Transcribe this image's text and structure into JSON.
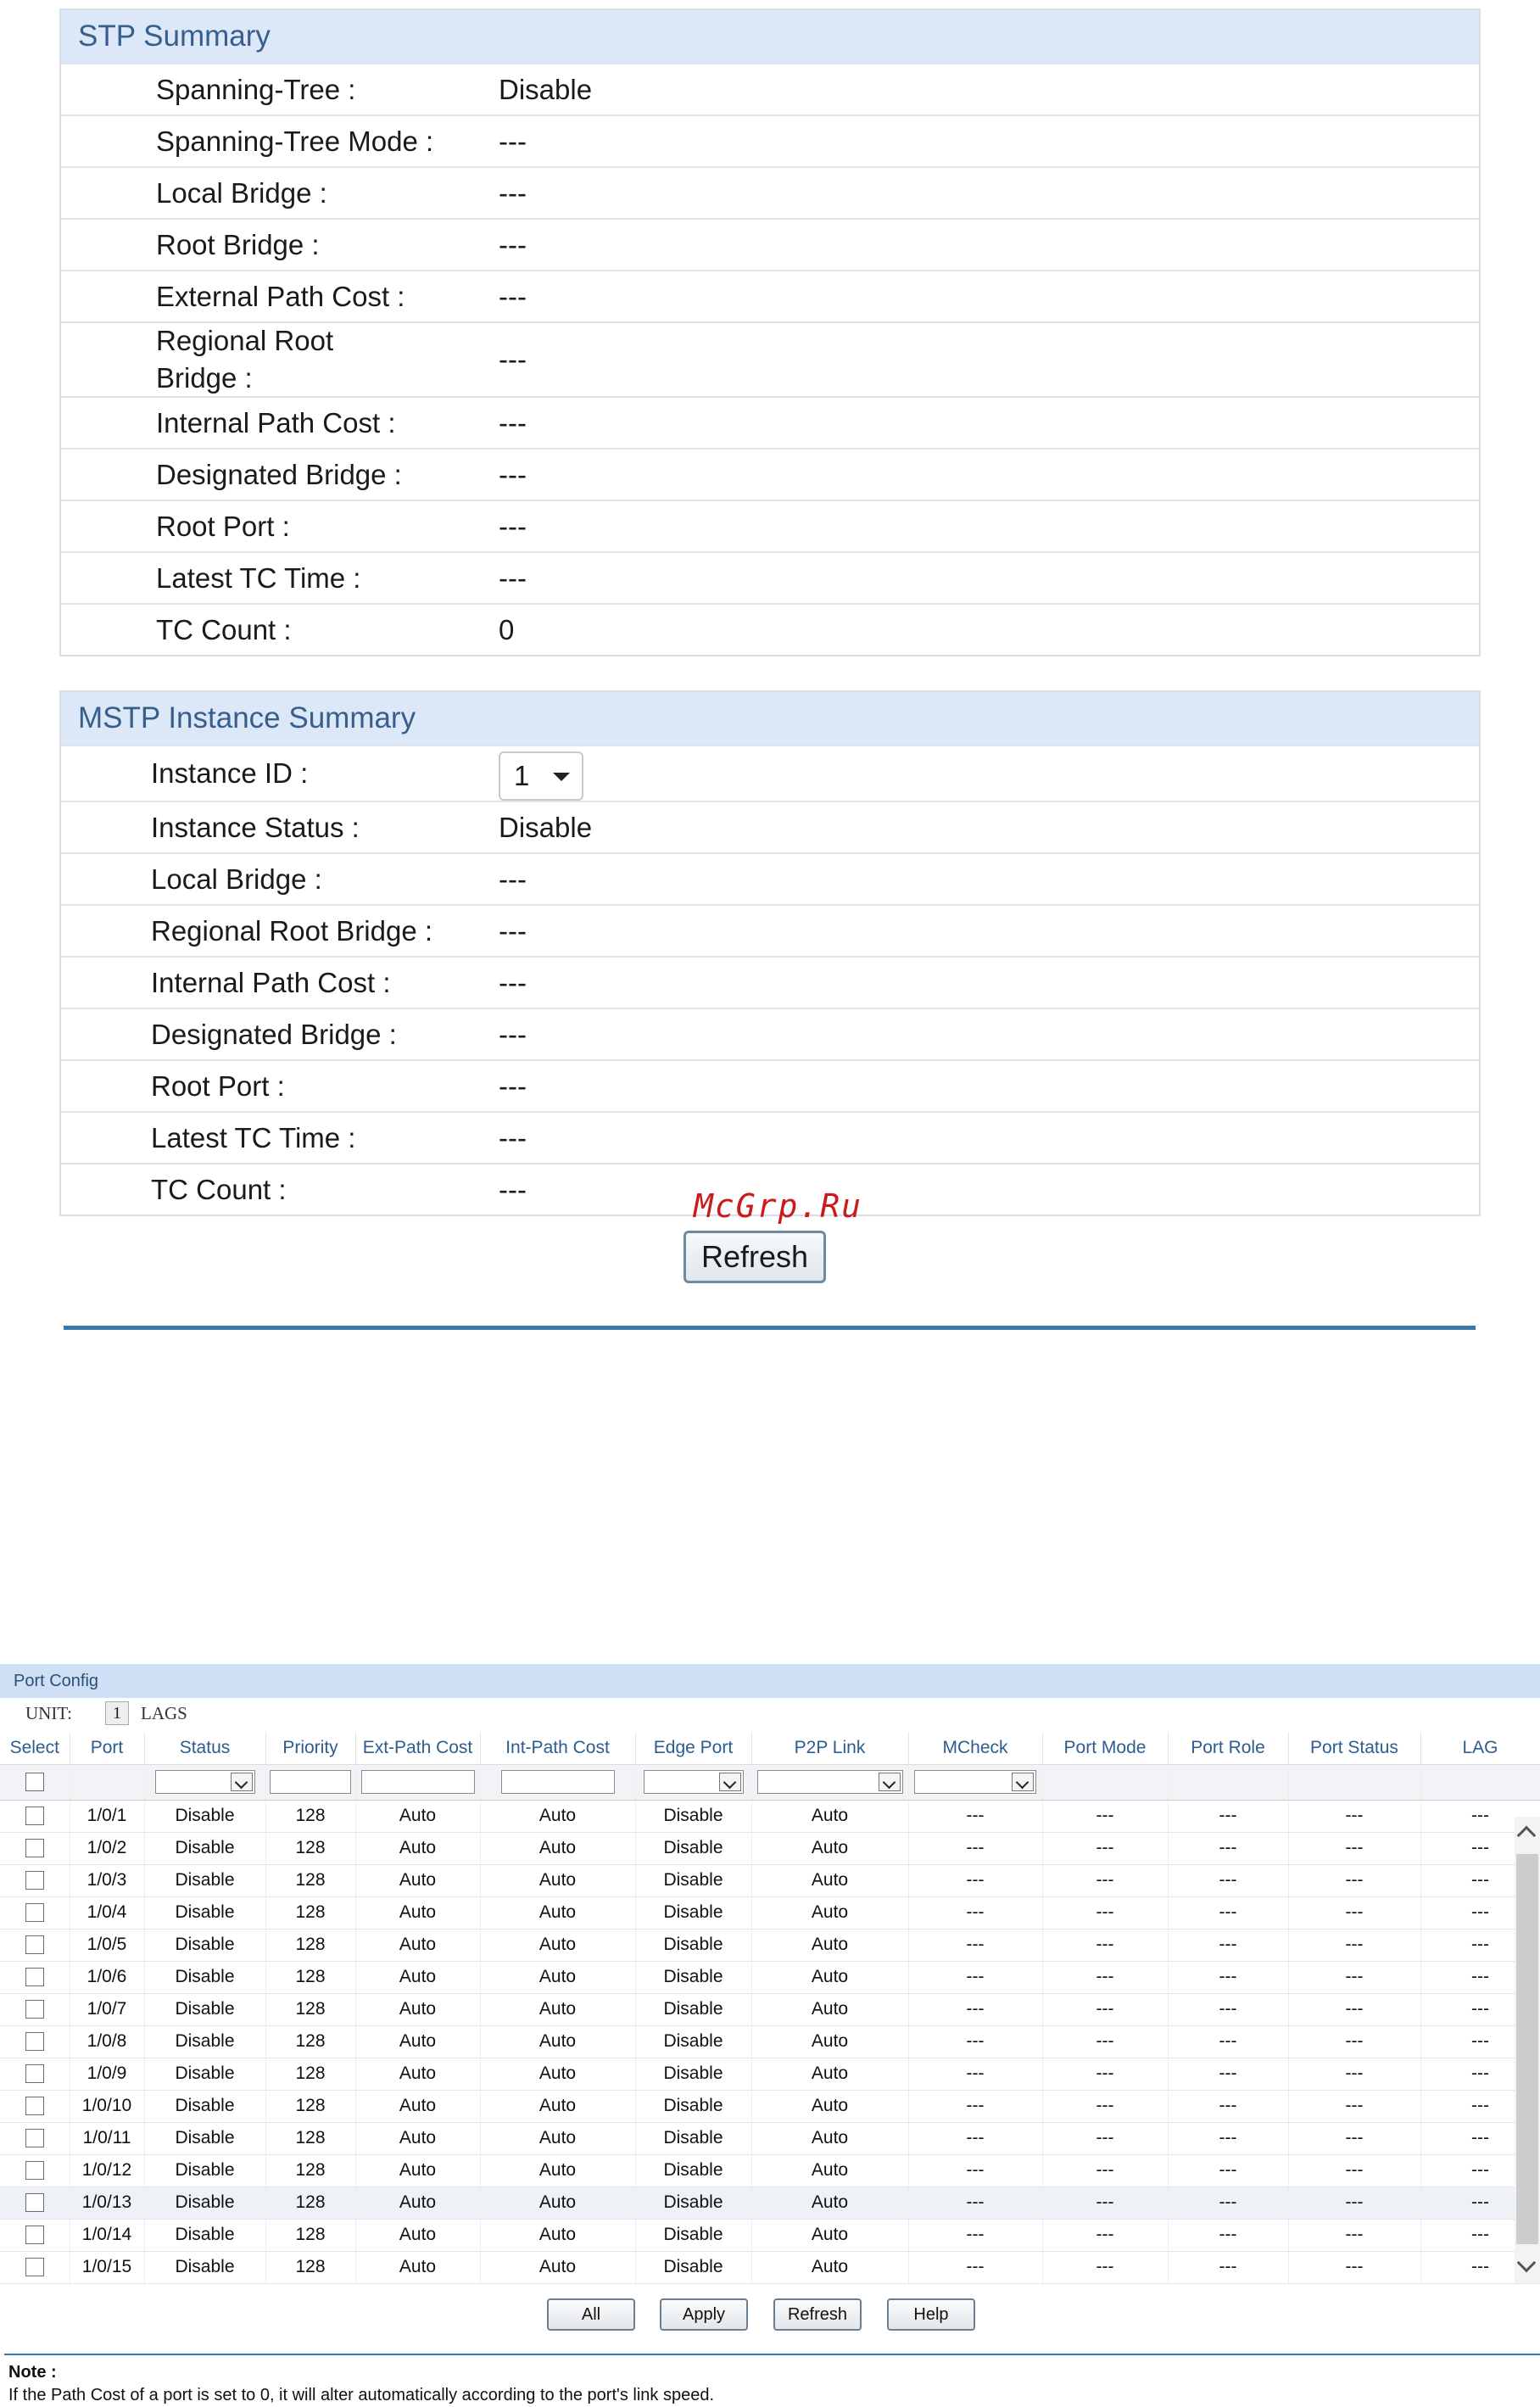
{
  "stp_summary": {
    "title": "STP Summary",
    "rows": [
      {
        "label": "Spanning-Tree :",
        "value": "Disable"
      },
      {
        "label": "Spanning-Tree Mode :",
        "value": "---"
      },
      {
        "label": "Local Bridge :",
        "value": "---"
      },
      {
        "label": "Root Bridge :",
        "value": "---"
      },
      {
        "label": "External Path Cost :",
        "value": "---"
      },
      {
        "label": "Regional Root Bridge :",
        "value": "---"
      },
      {
        "label": "Internal Path Cost :",
        "value": "---"
      },
      {
        "label": "Designated Bridge :",
        "value": "---"
      },
      {
        "label": "Root Port :",
        "value": "---"
      },
      {
        "label": "Latest TC Time :",
        "value": "---"
      },
      {
        "label": "TC Count :",
        "value": "0"
      }
    ]
  },
  "mstp_summary": {
    "title": "MSTP Instance Summary",
    "instance_id_label": "Instance ID :",
    "instance_id_value": "1",
    "rows": [
      {
        "label": "Instance Status :",
        "value": "Disable"
      },
      {
        "label": "Local Bridge :",
        "value": "---"
      },
      {
        "label": "Regional Root Bridge :",
        "value": "---"
      },
      {
        "label": "Internal Path Cost :",
        "value": "---"
      },
      {
        "label": "Designated Bridge :",
        "value": "---"
      },
      {
        "label": "Root Port :",
        "value": "---"
      },
      {
        "label": "Latest TC Time :",
        "value": "---"
      },
      {
        "label": "TC Count :",
        "value": "---"
      }
    ]
  },
  "refresh_label": "Refresh",
  "watermark": "McGrp.Ru",
  "port_config": {
    "title": "Port Config",
    "unit_label": "UNIT:",
    "unit_value": "1",
    "lags_label": "LAGS",
    "columns": [
      "Select",
      "Port",
      "Status",
      "Priority",
      "Ext-Path Cost",
      "Int-Path Cost",
      "Edge Port",
      "P2P Link",
      "MCheck",
      "Port Mode",
      "Port Role",
      "Port Status",
      "LAG"
    ],
    "rows": [
      [
        "1/0/1",
        "Disable",
        "128",
        "Auto",
        "Auto",
        "Disable",
        "Auto",
        "---",
        "---",
        "---",
        "---",
        "---"
      ],
      [
        "1/0/2",
        "Disable",
        "128",
        "Auto",
        "Auto",
        "Disable",
        "Auto",
        "---",
        "---",
        "---",
        "---",
        "---"
      ],
      [
        "1/0/3",
        "Disable",
        "128",
        "Auto",
        "Auto",
        "Disable",
        "Auto",
        "---",
        "---",
        "---",
        "---",
        "---"
      ],
      [
        "1/0/4",
        "Disable",
        "128",
        "Auto",
        "Auto",
        "Disable",
        "Auto",
        "---",
        "---",
        "---",
        "---",
        "---"
      ],
      [
        "1/0/5",
        "Disable",
        "128",
        "Auto",
        "Auto",
        "Disable",
        "Auto",
        "---",
        "---",
        "---",
        "---",
        "---"
      ],
      [
        "1/0/6",
        "Disable",
        "128",
        "Auto",
        "Auto",
        "Disable",
        "Auto",
        "---",
        "---",
        "---",
        "---",
        "---"
      ],
      [
        "1/0/7",
        "Disable",
        "128",
        "Auto",
        "Auto",
        "Disable",
        "Auto",
        "---",
        "---",
        "---",
        "---",
        "---"
      ],
      [
        "1/0/8",
        "Disable",
        "128",
        "Auto",
        "Auto",
        "Disable",
        "Auto",
        "---",
        "---",
        "---",
        "---",
        "---"
      ],
      [
        "1/0/9",
        "Disable",
        "128",
        "Auto",
        "Auto",
        "Disable",
        "Auto",
        "---",
        "---",
        "---",
        "---",
        "---"
      ],
      [
        "1/0/10",
        "Disable",
        "128",
        "Auto",
        "Auto",
        "Disable",
        "Auto",
        "---",
        "---",
        "---",
        "---",
        "---"
      ],
      [
        "1/0/11",
        "Disable",
        "128",
        "Auto",
        "Auto",
        "Disable",
        "Auto",
        "---",
        "---",
        "---",
        "---",
        "---"
      ],
      [
        "1/0/12",
        "Disable",
        "128",
        "Auto",
        "Auto",
        "Disable",
        "Auto",
        "---",
        "---",
        "---",
        "---",
        "---"
      ],
      [
        "1/0/13",
        "Disable",
        "128",
        "Auto",
        "Auto",
        "Disable",
        "Auto",
        "---",
        "---",
        "---",
        "---",
        "---"
      ],
      [
        "1/0/14",
        "Disable",
        "128",
        "Auto",
        "Auto",
        "Disable",
        "Auto",
        "---",
        "---",
        "---",
        "---",
        "---"
      ],
      [
        "1/0/15",
        "Disable",
        "128",
        "Auto",
        "Auto",
        "Disable",
        "Auto",
        "---",
        "---",
        "---",
        "---",
        "---"
      ]
    ],
    "buttons": {
      "all": "All",
      "apply": "Apply",
      "refresh": "Refresh",
      "help": "Help"
    }
  },
  "note": {
    "title": "Note :",
    "text": "If the Path Cost of a port is set to 0, it will alter automatically according to the port's link speed."
  },
  "colors": {
    "header_bg": "#dce8f8",
    "header_text": "#385f8c",
    "divider": "#3a78a8",
    "watermark": "#cc1a1a"
  }
}
